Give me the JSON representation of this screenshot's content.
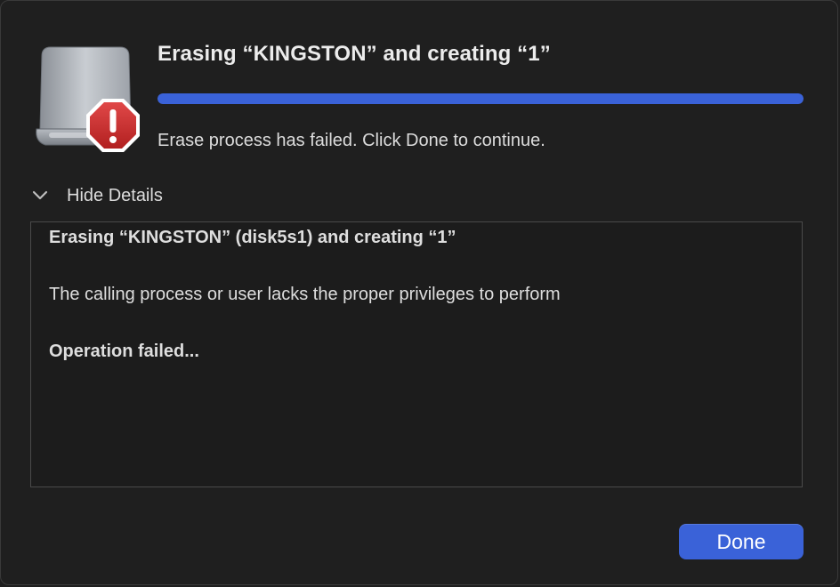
{
  "dialog": {
    "title": "Erasing “KINGSTON” and creating “1”",
    "progress_percent": 100,
    "status": "Erase process has failed. Click Done to continue.",
    "details_toggle_label": "Hide Details",
    "log": {
      "line1": "Erasing “KINGSTON” (disk5s1) and creating “1”",
      "line2": "The calling process or user lacks the proper privileges to perform",
      "line3": "Operation failed..."
    },
    "done_label": "Done",
    "icons": {
      "drive": "external-drive-icon",
      "error": "error-badge-icon",
      "chevron": "chevron-down-icon"
    },
    "colors": {
      "accent": "#3a62d8",
      "error": "#c62a2a"
    }
  }
}
